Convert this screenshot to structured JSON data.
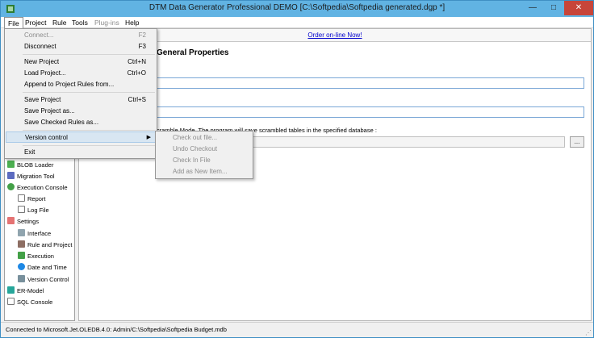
{
  "window": {
    "title": "DTM Data Generator Professional DEMO [C:\\Softpedia\\Softpedia generated.dgp *]",
    "min": "—",
    "max": "□",
    "close": "✕"
  },
  "menubar": [
    "File",
    "Project",
    "Rule",
    "Tools",
    "Plug-ins",
    "Help"
  ],
  "file_menu": [
    {
      "label": "Connect...",
      "shortcut": "F2"
    },
    {
      "label": "Disconnect",
      "shortcut": "F3"
    },
    {
      "label": "New Project",
      "shortcut": "Ctrl+N"
    },
    {
      "label": "Load Project...",
      "shortcut": "Ctrl+O"
    },
    {
      "label": "Append to Project Rules from...",
      "shortcut": ""
    },
    {
      "label": "Save Project",
      "shortcut": "Ctrl+S"
    },
    {
      "label": "Save Project as...",
      "shortcut": ""
    },
    {
      "label": "Save Checked Rules as...",
      "shortcut": ""
    },
    {
      "label": "Version control",
      "shortcut": ""
    },
    {
      "label": "Exit",
      "shortcut": ""
    }
  ],
  "version_submenu": [
    "Check out file...",
    "Undo Checkout",
    "Check In File",
    "Add as New Item..."
  ],
  "tree": [
    "BLOB Loader",
    "Migration Tool",
    "Execution Console",
    "Report",
    "Log File",
    "Settings",
    "Interface",
    "Rule and Project",
    "Execution",
    "Date and Time",
    "Version Control",
    "ER-Model",
    "SQL Console"
  ],
  "main": {
    "order_link": "Order on-line Now!",
    "section_title": "General Properties",
    "scramble_text": "cramble Mode. The program will save scrambled tables in the specified database :",
    "browse": "..."
  },
  "status": "Connected to Microsoft.Jet.OLEDB.4.0: Admin/C:\\Softpedia\\Softpedia Budget.mdb",
  "grip": "⋰"
}
